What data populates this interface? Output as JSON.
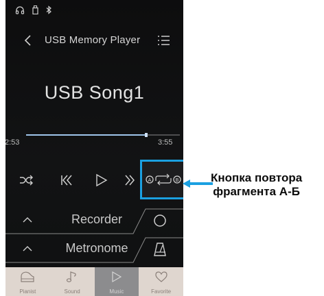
{
  "status_bar": {
    "icons": [
      "headphones-icon",
      "usb-drive-icon",
      "bluetooth-icon"
    ]
  },
  "header": {
    "title": "USB Memory Player",
    "back_icon": "chevron-left-icon",
    "list_icon": "list-icon"
  },
  "player": {
    "song_title": "USB Song1",
    "elapsed": "2:53",
    "total": "3:55",
    "progress": 0.78,
    "controls": [
      "shuffle-icon",
      "previous-icon",
      "play-icon",
      "fast-forward-icon",
      "ab-repeat-icon"
    ]
  },
  "panels": [
    {
      "label": "Recorder",
      "icon": "record-circle-icon"
    },
    {
      "label": "Metronome",
      "icon": "metronome-icon"
    }
  ],
  "bottom_nav": [
    {
      "label": "Pianist",
      "icon": "piano-icon"
    },
    {
      "label": "Sound",
      "icon": "music-note-icon"
    },
    {
      "label": "Music",
      "icon": "play-icon",
      "active": true
    },
    {
      "label": "Favorite",
      "icon": "heart-icon"
    }
  ],
  "callout": {
    "line1": "Кнопка повтора",
    "line2": "фрагмента А-Б"
  },
  "colors": {
    "highlight": "#1ba0e1",
    "accent_progress": "#9fc6ec",
    "nav_bg": "#dfd6cf"
  }
}
